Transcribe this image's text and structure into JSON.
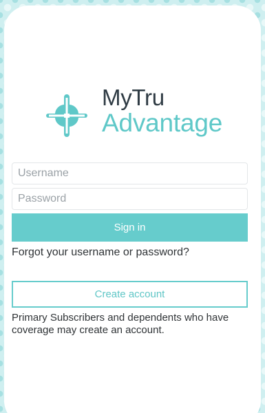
{
  "app": {
    "logo_line1": "MyTru",
    "logo_line2": "Advantage",
    "logo_icon": "four-leaf-clover-icon"
  },
  "login_form": {
    "username_placeholder": "Username",
    "username_value": "",
    "password_placeholder": "Password",
    "password_value": "",
    "signin_label": "Sign in",
    "forgot_label": "Forgot your username or password?",
    "create_account_label": "Create account",
    "note": "Primary Subscribers and dependents who have coverage may create an account."
  },
  "colors": {
    "accent": "#66cccc",
    "logo_accent": "#5fc8c8",
    "logo_dark": "#2f3b44",
    "background_pattern": "#cfeff0",
    "text": "#2f3336"
  }
}
